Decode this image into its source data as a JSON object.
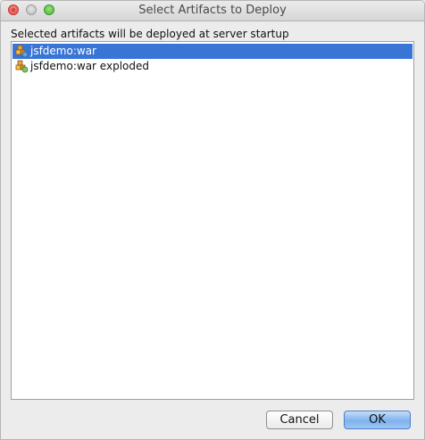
{
  "window": {
    "title": "Select Artifacts to Deploy"
  },
  "dialog": {
    "instruction": "Selected artifacts will be deployed at server startup",
    "artifacts": [
      {
        "label": "jsfdemo:war",
        "selected": true,
        "icon": "artifact-icon"
      },
      {
        "label": "jsfdemo:war exploded",
        "selected": false,
        "icon": "artifact-icon"
      }
    ],
    "buttons": {
      "cancel": "Cancel",
      "ok": "OK"
    }
  },
  "colors": {
    "selection": "#3875d7",
    "background": "#ececec",
    "default_button": "#7fb2ee"
  }
}
